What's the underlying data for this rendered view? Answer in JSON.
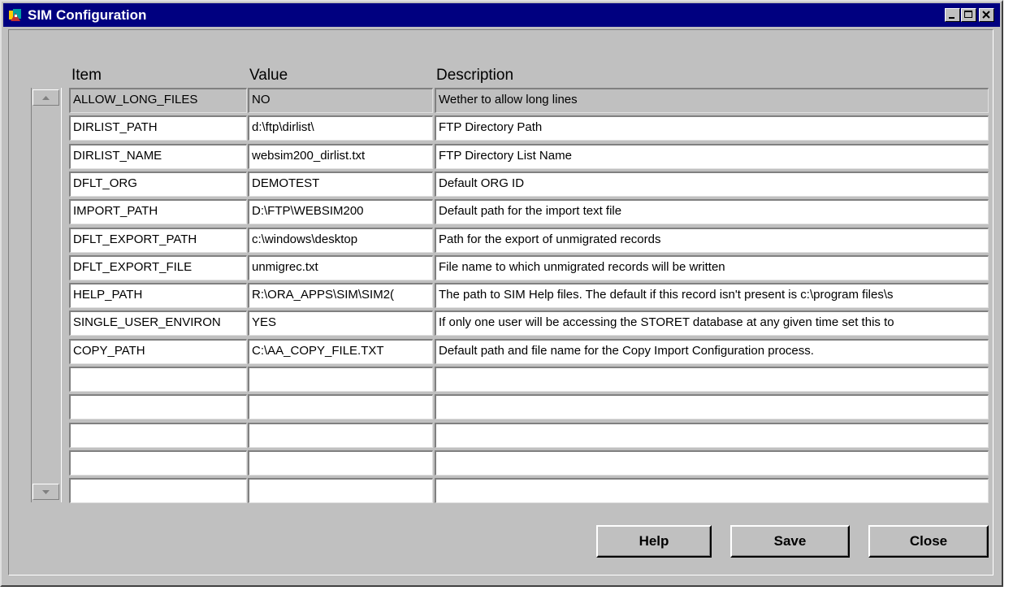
{
  "window": {
    "title": "SIM Configuration"
  },
  "headers": {
    "item": "Item",
    "value": "Value",
    "description": "Description"
  },
  "rows": [
    {
      "item": "ALLOW_LONG_FILES",
      "value": "NO",
      "description": "Wether to allow long lines"
    },
    {
      "item": "DIRLIST_PATH",
      "value": "d:\\ftp\\dirlist\\",
      "description": "FTP Directory Path"
    },
    {
      "item": "DIRLIST_NAME",
      "value": "websim200_dirlist.txt",
      "description": "FTP Directory List Name"
    },
    {
      "item": "DFLT_ORG",
      "value": "DEMOTEST",
      "description": "Default ORG ID"
    },
    {
      "item": "IMPORT_PATH",
      "value": "D:\\FTP\\WEBSIM200",
      "description": "Default path for the import text file"
    },
    {
      "item": "DFLT_EXPORT_PATH",
      "value": "c:\\windows\\desktop",
      "description": "Path for the export of unmigrated records"
    },
    {
      "item": "DFLT_EXPORT_FILE",
      "value": "unmigrec.txt",
      "description": "File name to which unmigrated records will be written"
    },
    {
      "item": "HELP_PATH",
      "value": "R:\\ORA_APPS\\SIM\\SIM2(",
      "description": "The path to SIM Help files. The default if this record isn't present is c:\\program files\\s"
    },
    {
      "item": "SINGLE_USER_ENVIRON",
      "value": "YES",
      "description": "If only one user will be accessing the STORET database at any given time set this to"
    },
    {
      "item": "COPY_PATH",
      "value": "C:\\AA_COPY_FILE.TXT",
      "description": "Default path and file name for the Copy Import Configuration process."
    },
    {
      "item": "",
      "value": "",
      "description": ""
    },
    {
      "item": "",
      "value": "",
      "description": ""
    },
    {
      "item": "",
      "value": "",
      "description": ""
    },
    {
      "item": "",
      "value": "",
      "description": ""
    },
    {
      "item": "",
      "value": "",
      "description": ""
    }
  ],
  "buttons": {
    "help": "Help",
    "save": "Save",
    "close": "Close"
  },
  "icons": {
    "app": "sim-app-icon",
    "minimize": "minimize-icon",
    "maximize": "maximize-icon",
    "close": "close-icon",
    "scroll_up": "arrow-up-icon",
    "scroll_down": "arrow-down-icon"
  },
  "colors": {
    "titlebar": "#000080",
    "face": "#c0c0c0",
    "cell": "#ffffff"
  }
}
